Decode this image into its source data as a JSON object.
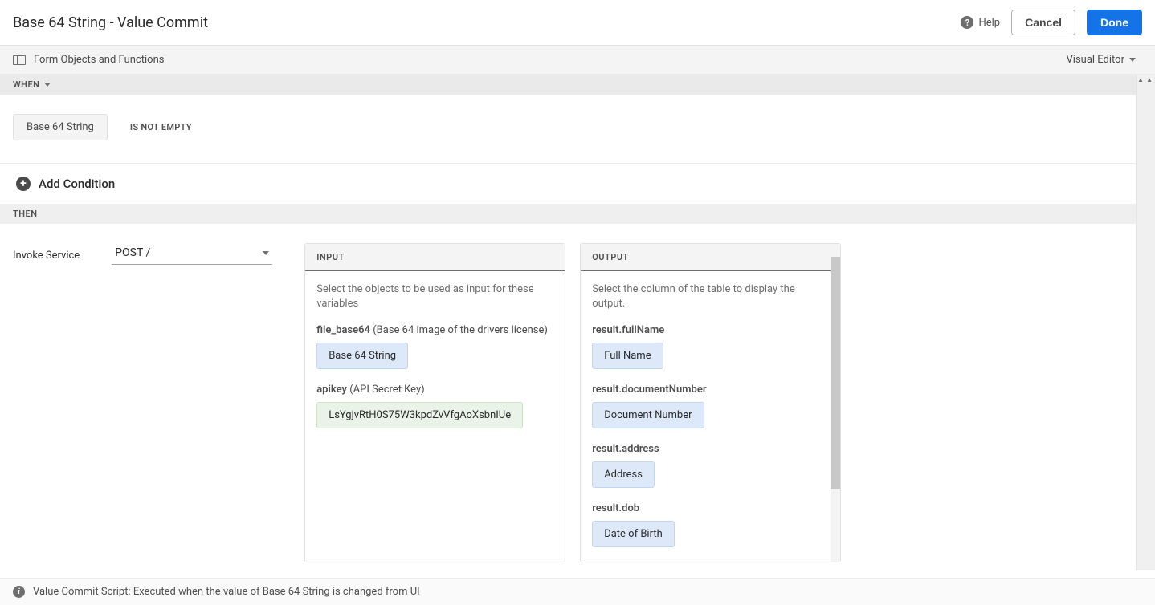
{
  "header": {
    "title": "Base 64 String - Value Commit",
    "help": "Help",
    "cancel": "Cancel",
    "done": "Done"
  },
  "toolbar": {
    "form_objects": "Form Objects and Functions",
    "visual_editor": "Visual Editor"
  },
  "when": {
    "label": "WHEN",
    "subject": "Base 64 String",
    "operator": "IS NOT EMPTY"
  },
  "add_condition": "Add Condition",
  "then": {
    "label": "THEN",
    "action_label": "Invoke Service",
    "service": "POST /"
  },
  "input": {
    "header": "INPUT",
    "hint": "Select the objects to be used as input for these variables",
    "fields": [
      {
        "name": "file_base64",
        "desc": "(Base 64 image of the drivers license)",
        "token": "Base 64 String",
        "style": "blue"
      },
      {
        "name": "apikey",
        "desc": "(API Secret Key)",
        "token": "LsYgjvRtH0S75W3kpdZvVfgAoXsbnIUe",
        "style": "green"
      }
    ]
  },
  "output": {
    "header": "OUTPUT",
    "hint": "Select the column of the table to display the output.",
    "fields": [
      {
        "name": "result.fullName",
        "token": "Full Name"
      },
      {
        "name": "result.documentNumber",
        "token": "Document Number"
      },
      {
        "name": "result.address",
        "token": "Address"
      },
      {
        "name": "result.dob",
        "token": "Date of Birth"
      }
    ]
  },
  "footer": {
    "text": "Value Commit Script: Executed when the value of Base 64 String is changed from UI"
  }
}
